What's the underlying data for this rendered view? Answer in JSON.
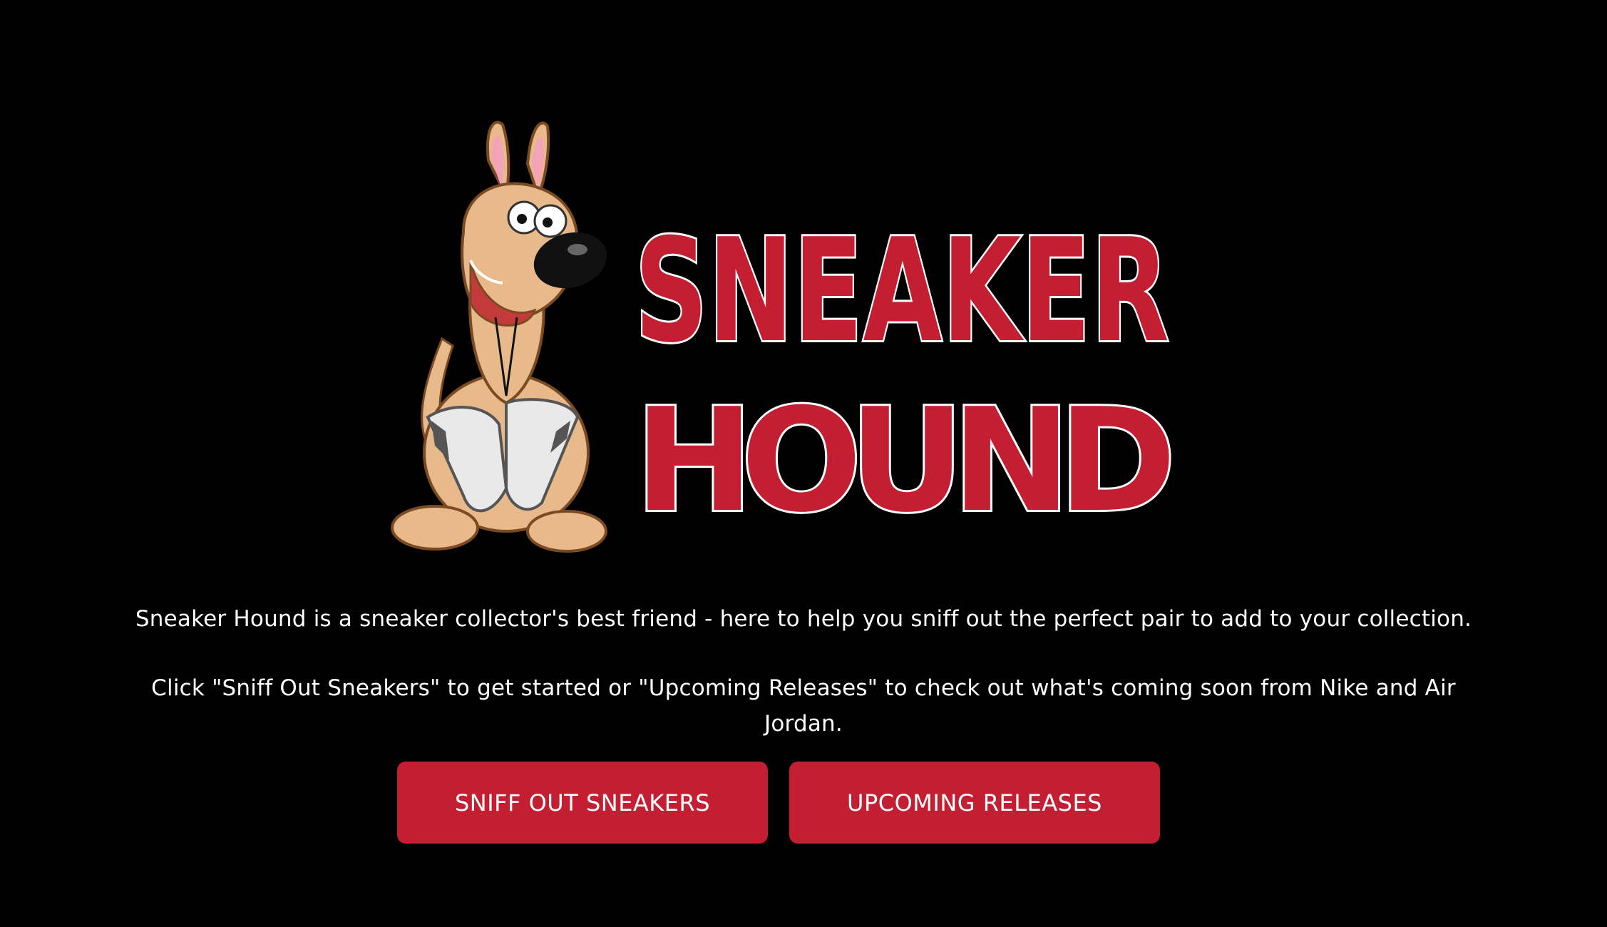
{
  "logo": {
    "line1": "SNEAKER",
    "line2": "HOUND",
    "icon": "dog-with-sneakers-icon",
    "text_color": "#c41e32"
  },
  "intro": {
    "line1": "Sneaker Hound is a sneaker collector's best friend - here to help you sniff out the perfect pair to add to your collection.",
    "line2a": "Click \"Sniff Out Sneakers\" to get started or \"Upcoming Releases\" to check out what's coming soon from Nike and Air",
    "line2b": "Jordan."
  },
  "buttons": {
    "sniff_label": "SNIFF OUT SNEAKERS",
    "upcoming_label": "UPCOMING RELEASES",
    "color": "#c41e32"
  }
}
